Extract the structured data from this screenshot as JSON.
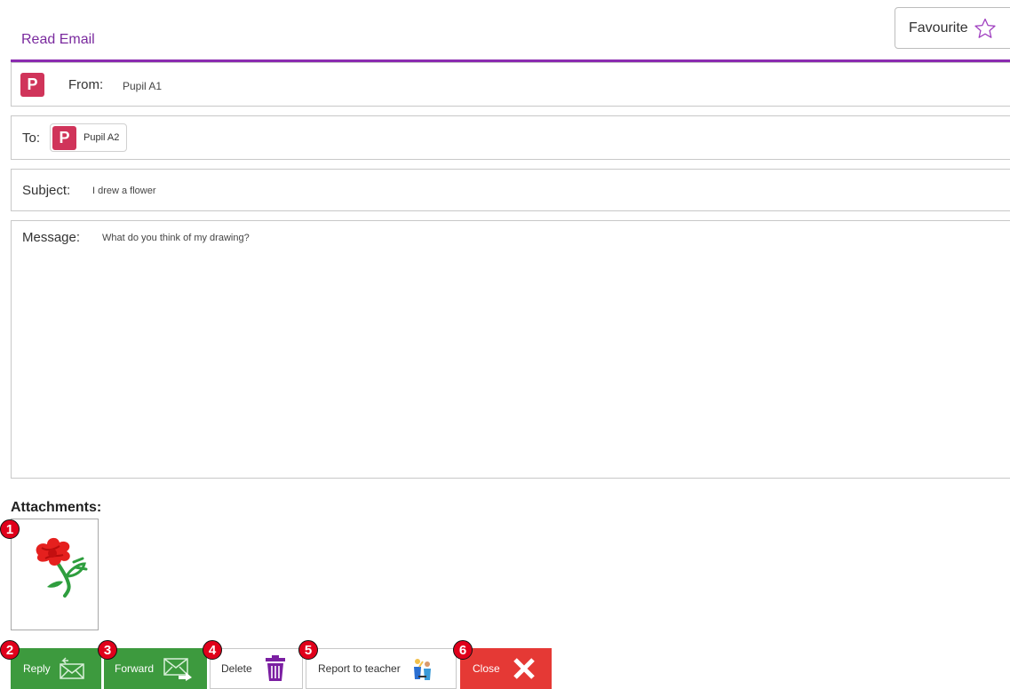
{
  "header": {
    "title": "Read Email",
    "favourite_label": "Favourite"
  },
  "from": {
    "label": "From:",
    "avatar_letter": "P",
    "value": "Pupil A1"
  },
  "to": {
    "label": "To:",
    "avatar_letter": "P",
    "value": "Pupil A2"
  },
  "subject": {
    "label": "Subject:",
    "value": "I drew a flower"
  },
  "message": {
    "label": "Message:",
    "value": "What do you think of my drawing?"
  },
  "attachments": {
    "label": "Attachments:"
  },
  "toolbar": {
    "reply_label": "Reply",
    "forward_label": "Forward",
    "delete_label": "Delete",
    "report_label": "Report to teacher",
    "close_label": "Close"
  },
  "badges": [
    "1",
    "2",
    "3",
    "4",
    "5",
    "6"
  ],
  "colors": {
    "accent_purple": "#8a2bb0",
    "avatar_red": "#d0345a",
    "button_green": "#3d9a3e",
    "button_red": "#e53935",
    "badge_red": "#e0001b"
  },
  "icons": {
    "favourite": "star-outline-icon",
    "reply": "reply-envelope-icon",
    "forward": "forward-envelope-icon",
    "delete": "trash-icon",
    "report": "report-teacher-icon",
    "close": "close-x-icon"
  }
}
